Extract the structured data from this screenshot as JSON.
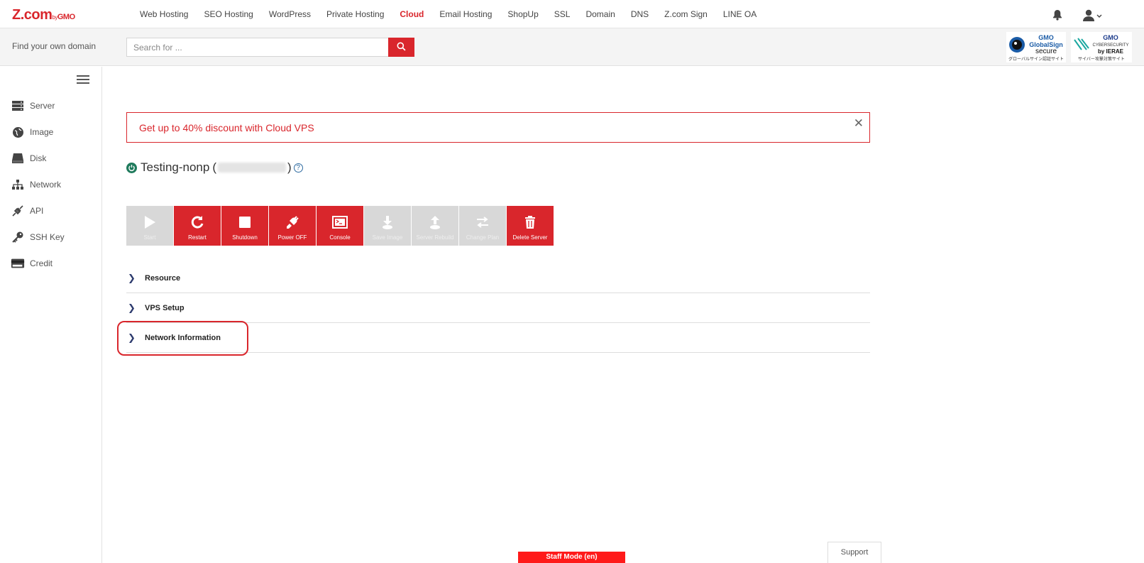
{
  "brand": {
    "logo": "Z.com",
    "by": "by",
    "gmo": "GMO"
  },
  "nav": {
    "links": [
      "Web Hosting",
      "SEO Hosting",
      "WordPress",
      "Private Hosting",
      "Cloud",
      "Email Hosting",
      "ShopUp",
      "SSL",
      "Domain",
      "DNS",
      "Z.com Sign",
      "LINE OA"
    ],
    "active": "Cloud"
  },
  "search": {
    "label": "Find your own domain",
    "placeholder": "Search for ..."
  },
  "badges": {
    "globalsign": {
      "line1": "GMO",
      "line2": "GlobalSign",
      "line3": "secure",
      "sub": "グローバルサイン認証サイト"
    },
    "cybersecurity": {
      "line1": "GMO",
      "line2": "CYBERSECURITY",
      "line3": "by IERAE",
      "sub": "サイバー攻撃対策サイト"
    }
  },
  "sidebar": {
    "items": [
      {
        "label": "Server",
        "icon": "server-icon"
      },
      {
        "label": "Image",
        "icon": "globe-icon"
      },
      {
        "label": "Disk",
        "icon": "disk-icon"
      },
      {
        "label": "Network",
        "icon": "network-icon"
      },
      {
        "label": "API",
        "icon": "api-icon"
      },
      {
        "label": "SSH Key",
        "icon": "key-icon"
      },
      {
        "label": "Credit",
        "icon": "credit-card-icon"
      }
    ]
  },
  "promo": {
    "text": "Get up to 40% discount with Cloud VPS",
    "close": "✕"
  },
  "server": {
    "name": "Testing-nonp",
    "open_paren": "(",
    "close_paren": ")",
    "help": "?"
  },
  "actions": [
    {
      "label": "Start",
      "enabled": false
    },
    {
      "label": "Restart",
      "enabled": true
    },
    {
      "label": "Shutdown",
      "enabled": true
    },
    {
      "label": "Power OFF",
      "enabled": true
    },
    {
      "label": "Console",
      "enabled": true
    },
    {
      "label": "Save Image",
      "enabled": false
    },
    {
      "label": "Server Rebuild",
      "enabled": false
    },
    {
      "label": "Change Plan",
      "enabled": false
    },
    {
      "label": "Delete Server",
      "enabled": true
    }
  ],
  "sections": [
    {
      "label": "Resource",
      "chevron": "❯"
    },
    {
      "label": "VPS Setup",
      "chevron": "❯"
    },
    {
      "label": "Network Information",
      "chevron": "❯"
    }
  ],
  "footer": {
    "staff_mode": "Staff Mode (en)",
    "support": "Support"
  },
  "colors": {
    "accent": "#d9262c",
    "power_on": "#1f7a5c",
    "disabled": "#d8d8d8"
  }
}
